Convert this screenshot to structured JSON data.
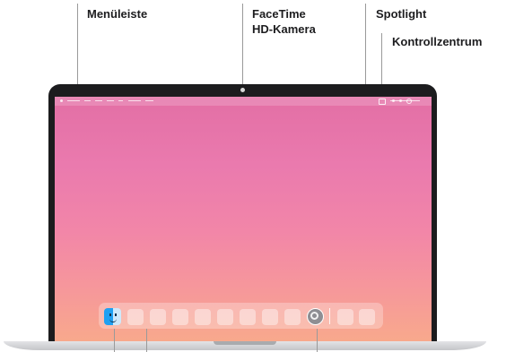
{
  "labels": {
    "menubar": "Menüleiste",
    "camera_line1": "FaceTime",
    "camera_line2": "HD-Kamera",
    "spotlight": "Spotlight",
    "control_center": "Kontrollzentrum"
  },
  "icons": [
    "apple-icon",
    "spotlight-search-icon",
    "control-center-icon",
    "finder-icon",
    "system-settings-icon"
  ],
  "colors": {
    "bezel": "#1c1c1e",
    "wallpaper_top": "#e36fa5",
    "wallpaper_bottom": "#f8a98c",
    "label_text": "#1d1d1f",
    "leader_line": "#9a9a9a"
  }
}
